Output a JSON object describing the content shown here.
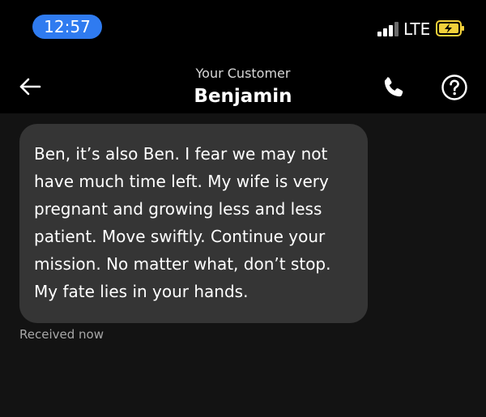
{
  "status_bar": {
    "time": "12:57",
    "network": "LTE",
    "signal_bars": 3,
    "signal_bars_total": 4,
    "battery_state": "charging",
    "accent_color": "#2f7bf0",
    "battery_color": "#f2d13a"
  },
  "header": {
    "subtitle": "Your Customer",
    "title": "Benjamin",
    "back_icon": "arrow-left-icon",
    "call_icon": "phone-icon",
    "help_icon": "question-circle-icon"
  },
  "messages": [
    {
      "text": "Ben, it’s also Ben. I fear we may not have much time left. My wife is very pregnant and growing less and less patient. Move swiftly. Continue your mission. No matter what, don’t stop. My fate lies in your hands.",
      "status": "Received now"
    }
  ]
}
